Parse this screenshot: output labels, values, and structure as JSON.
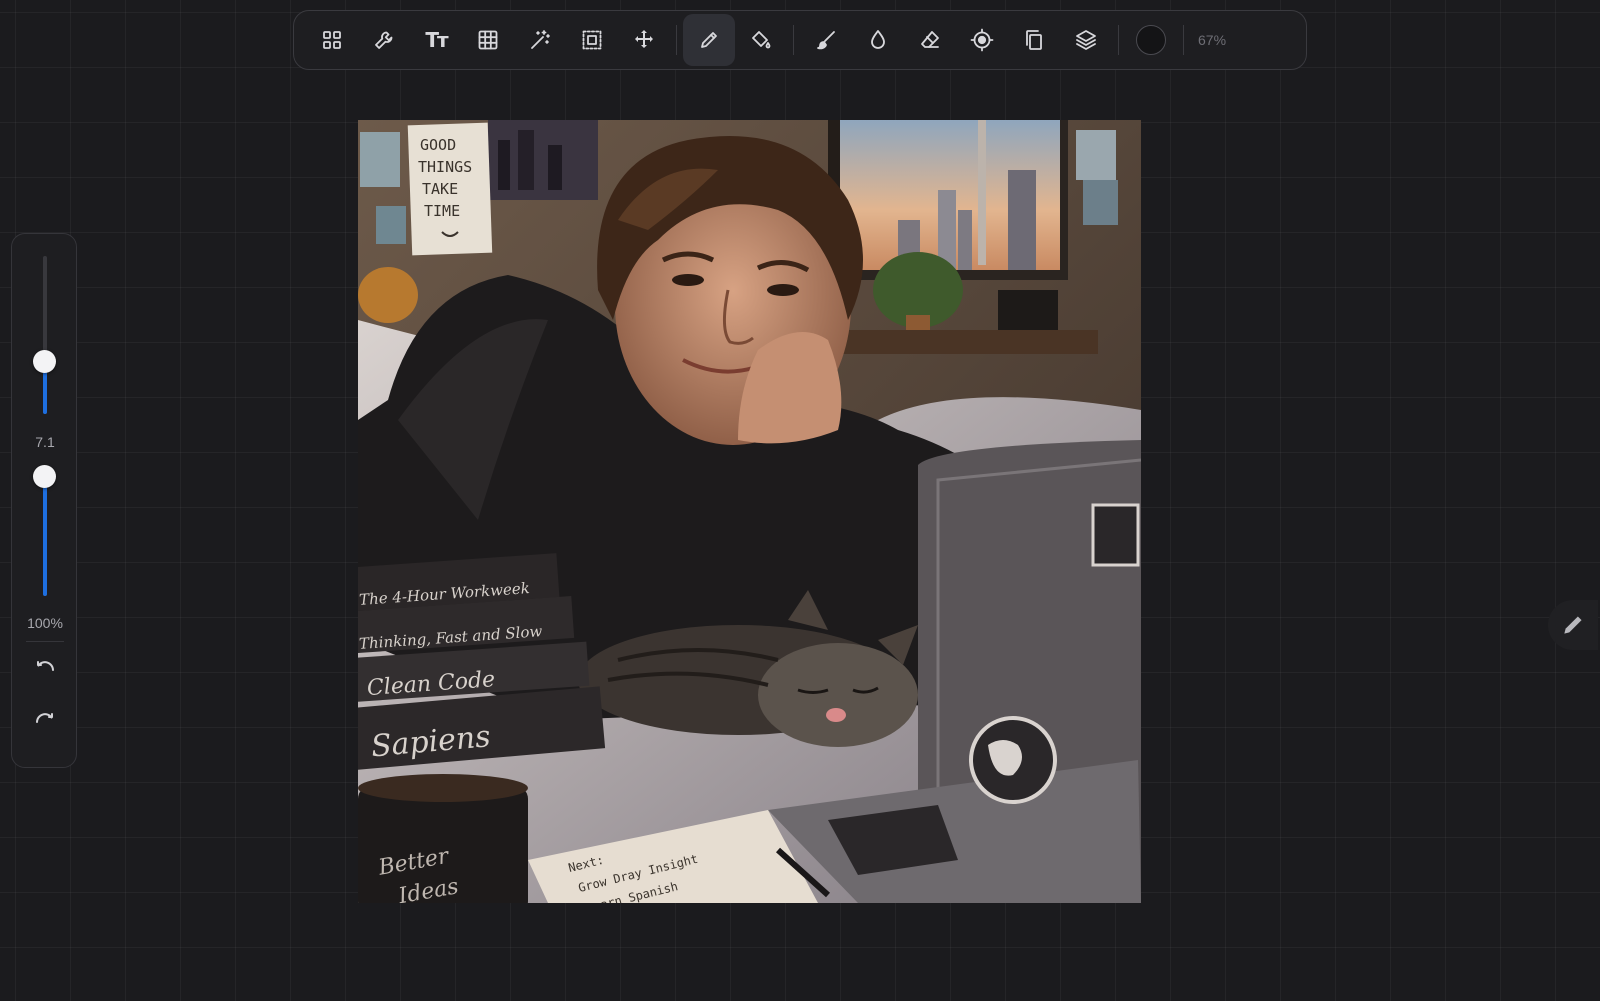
{
  "toolbar": {
    "tools": [
      {
        "name": "gallery",
        "icon": "grid-icon"
      },
      {
        "name": "settings",
        "icon": "wrench-icon"
      },
      {
        "name": "text",
        "icon": "text-tool-icon",
        "glyph": "Tт"
      },
      {
        "name": "grid",
        "icon": "table-grid-icon"
      },
      {
        "name": "magic",
        "icon": "magic-wand-icon"
      },
      {
        "name": "selection",
        "icon": "selection-icon"
      },
      {
        "name": "move",
        "icon": "move-icon"
      },
      {
        "name": "pencil",
        "icon": "pencil-icon",
        "active": true
      },
      {
        "name": "fill",
        "icon": "paint-bucket-icon"
      },
      {
        "name": "brush",
        "icon": "brush-icon"
      },
      {
        "name": "smudge",
        "icon": "smudge-drop-icon"
      },
      {
        "name": "eraser",
        "icon": "eraser-icon"
      },
      {
        "name": "target",
        "icon": "target-icon"
      },
      {
        "name": "duplicate",
        "icon": "copy-icon"
      },
      {
        "name": "layers",
        "icon": "layers-icon"
      }
    ],
    "color": "#141416",
    "zoom": "67%"
  },
  "side_panel": {
    "size_value": "7.1",
    "size_fraction": 0.33,
    "opacity_value": "100%",
    "opacity_fraction": 1.0
  },
  "canvas": {
    "poster_lines": [
      "GOOD",
      "THINGS",
      "TAKE",
      "TIME"
    ],
    "books": [
      "The 4-Hour Workweek",
      "Thinking, Fast and Slow",
      "Clean Code",
      "Sapiens"
    ],
    "mug_text": [
      "Better",
      "Ideas"
    ],
    "note_lines": [
      "Next:",
      "Grow Dray Insight",
      "Learn Spanish"
    ]
  },
  "accent": "#1e6fe0"
}
